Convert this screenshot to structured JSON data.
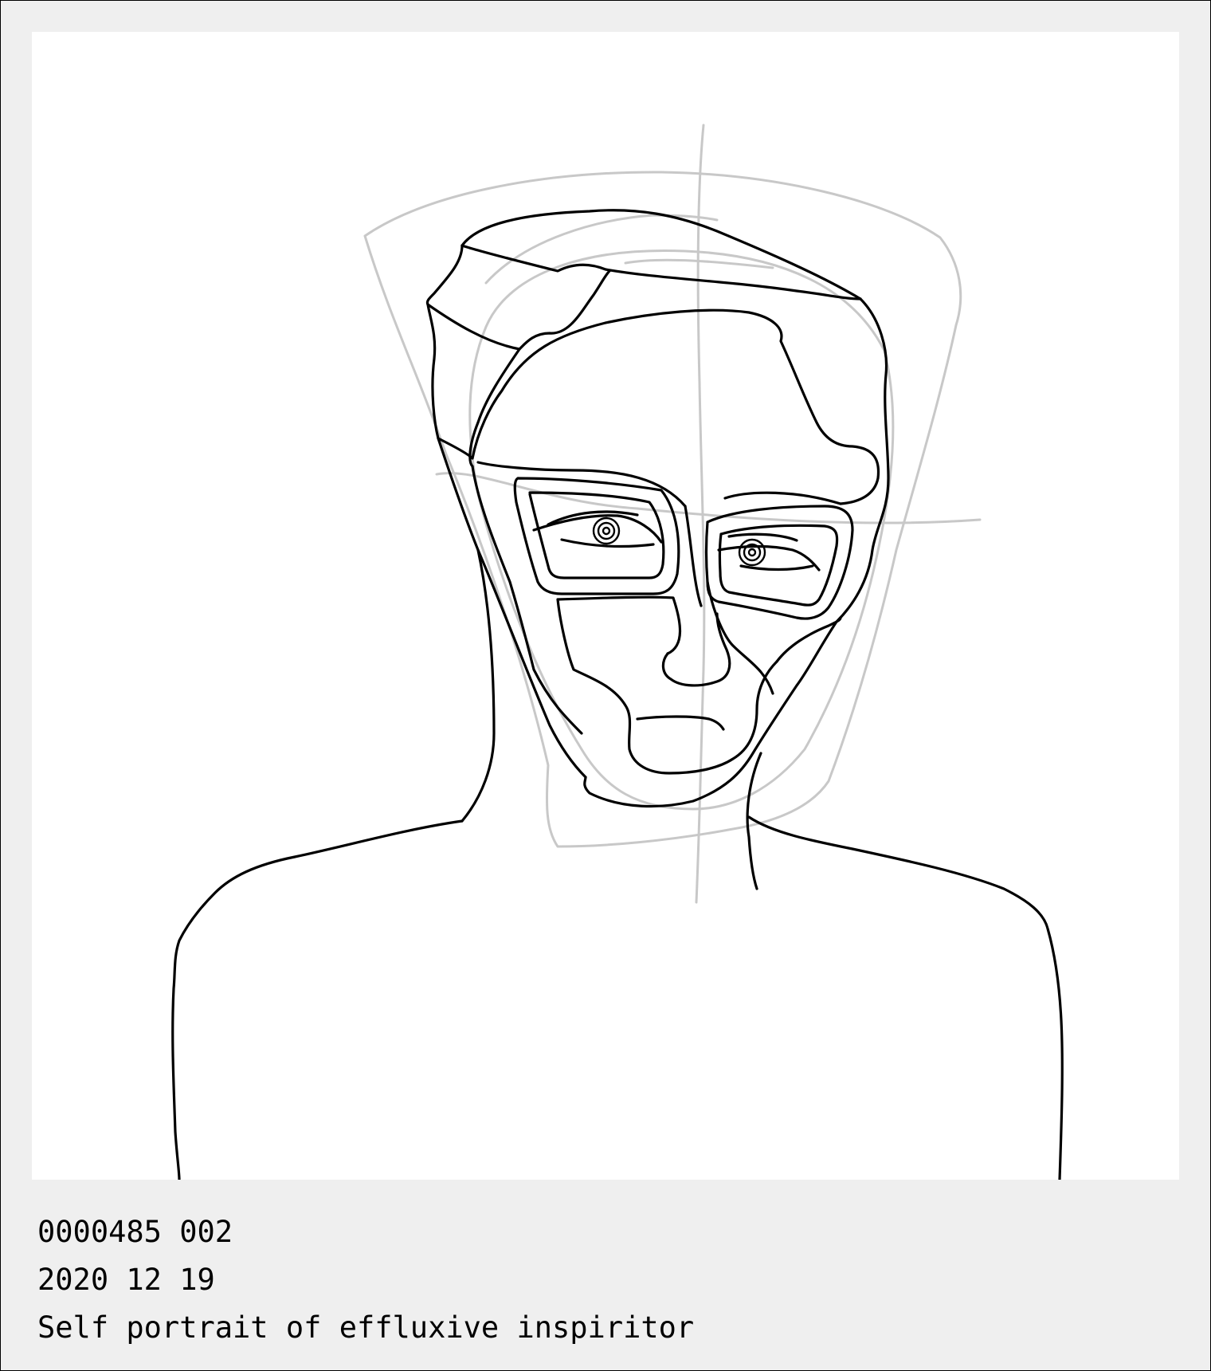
{
  "artwork": {
    "subject": "line-drawing-portrait",
    "stroke_color": "#000000",
    "guide_color": "#c8c8c8",
    "background": "#ffffff",
    "frame_color": "#efefef"
  },
  "caption": {
    "id_line": "0000485 002",
    "date_line": "2020 12 19",
    "title_line": "Self portrait of effluxive inspiritor"
  }
}
